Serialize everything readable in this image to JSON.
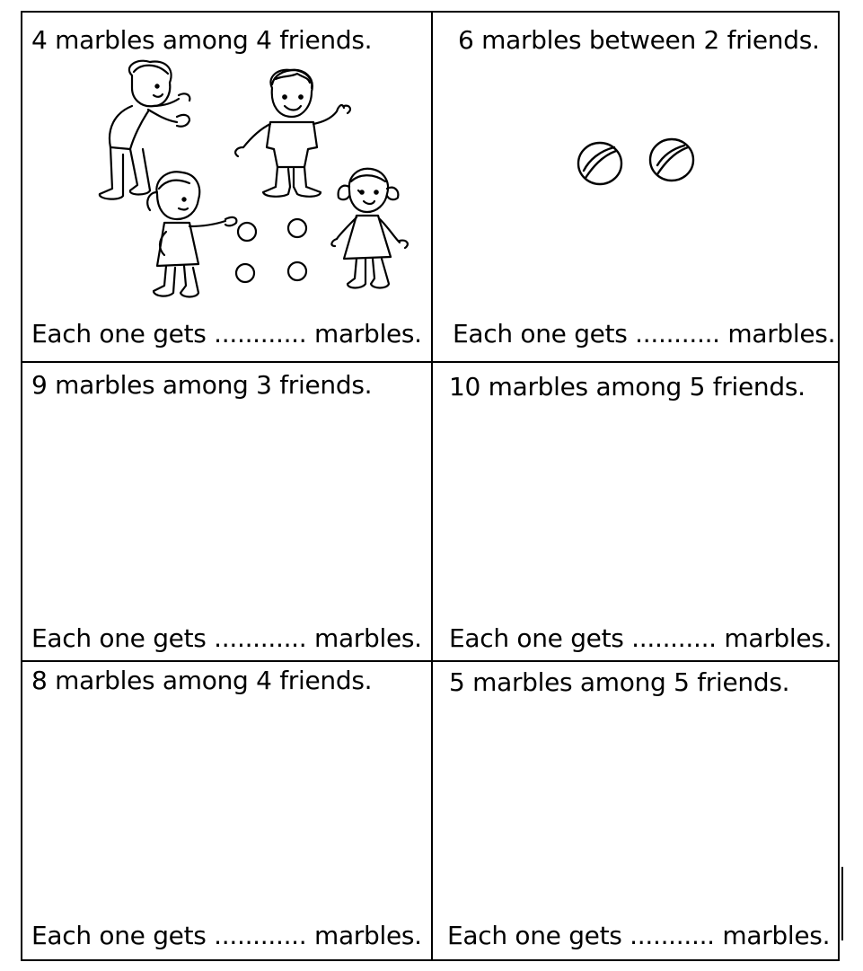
{
  "worksheet": {
    "problems": [
      {
        "question": "4 marbles among 4 friends.",
        "answer_prompt": "Each one gets ............ marbles."
      },
      {
        "question": "6 marbles between 2 friends.",
        "answer_prompt": "Each one gets ........... marbles."
      },
      {
        "question": "9 marbles among 3 friends.",
        "answer_prompt": "Each one gets ............ marbles."
      },
      {
        "question": "10 marbles among 5 friends.",
        "answer_prompt": "Each one gets ........... marbles."
      },
      {
        "question": "8 marbles among 4 friends.",
        "answer_prompt": "Each one gets ............ marbles."
      },
      {
        "question": "5 marbles among 5 friends.",
        "answer_prompt": "Each one gets ........... marbles."
      }
    ]
  },
  "icons": {
    "children": "children-illustration",
    "marble": "marble-icon"
  }
}
